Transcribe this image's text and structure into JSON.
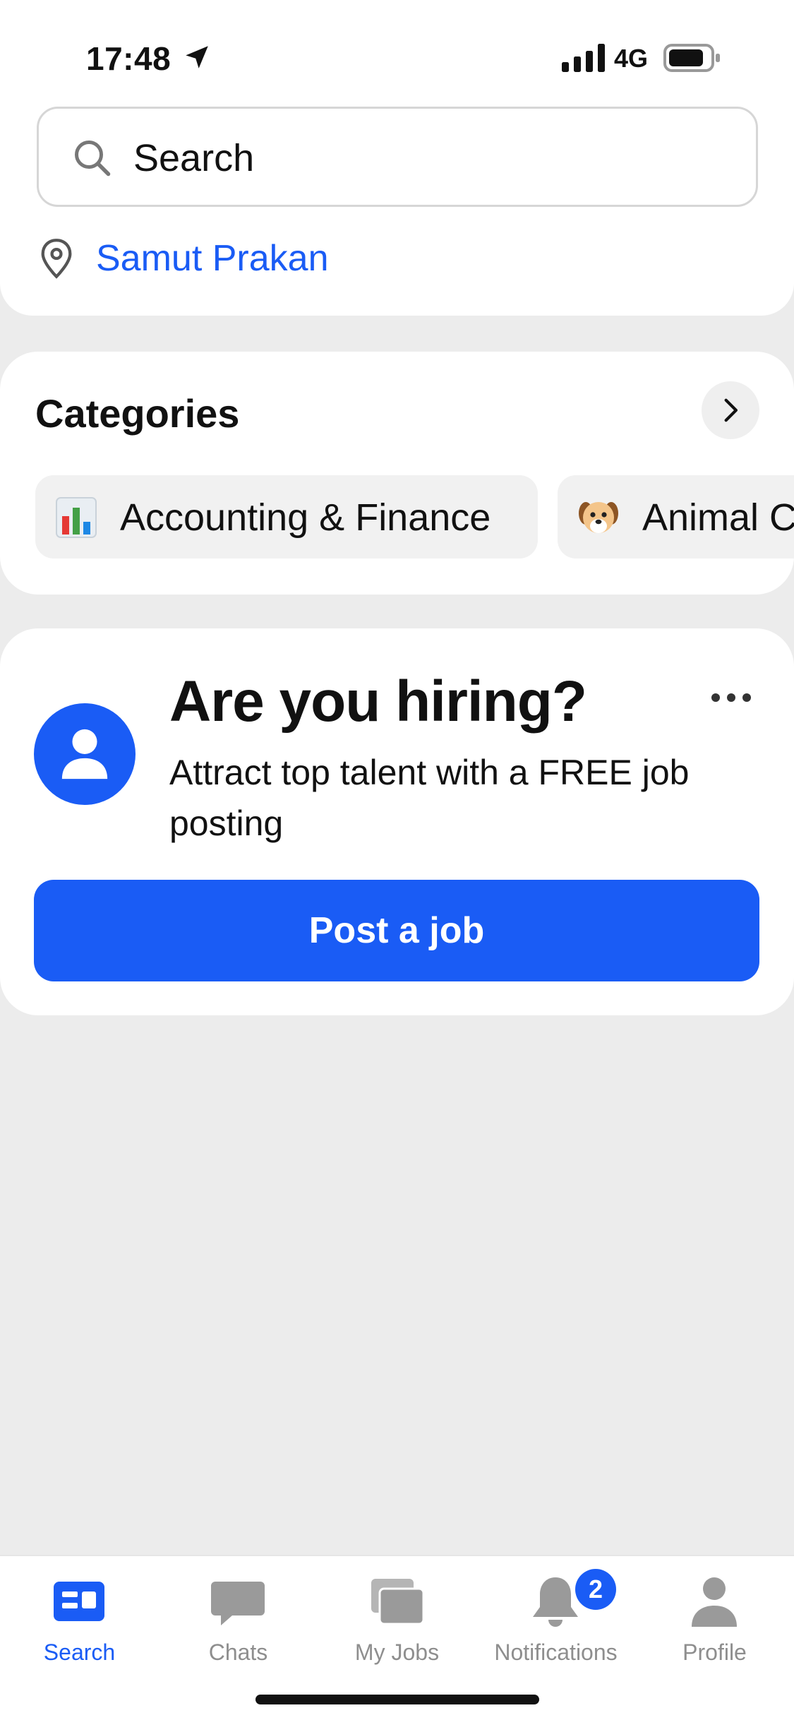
{
  "status_bar": {
    "time": "17:48",
    "network": "4G",
    "icons": [
      "location-arrow-icon",
      "signal-icon",
      "battery-icon"
    ]
  },
  "search": {
    "placeholder": "Search",
    "location": "Samut Prakan"
  },
  "categories": {
    "title": "Categories",
    "items": [
      {
        "label": "Accounting & Finance",
        "icon": "bar-chart-icon"
      },
      {
        "label": "Animal C",
        "icon": "dog-face-icon"
      }
    ]
  },
  "hiring": {
    "title": "Are you hiring?",
    "subtitle": "Attract top talent with a FREE job posting",
    "button": "Post a job"
  },
  "tab_bar": {
    "tabs": [
      {
        "label": "Search",
        "icon": "search-tab-icon",
        "active": true
      },
      {
        "label": "Chats",
        "icon": "chat-bubble-icon"
      },
      {
        "label": "My Jobs",
        "icon": "jobs-stack-icon"
      },
      {
        "label": "Notifications",
        "icon": "bell-icon",
        "badge": "2"
      },
      {
        "label": "Profile",
        "icon": "person-icon"
      }
    ]
  },
  "colors": {
    "accent": "#1a5cf5",
    "background": "#ececec",
    "card": "#ffffff"
  }
}
